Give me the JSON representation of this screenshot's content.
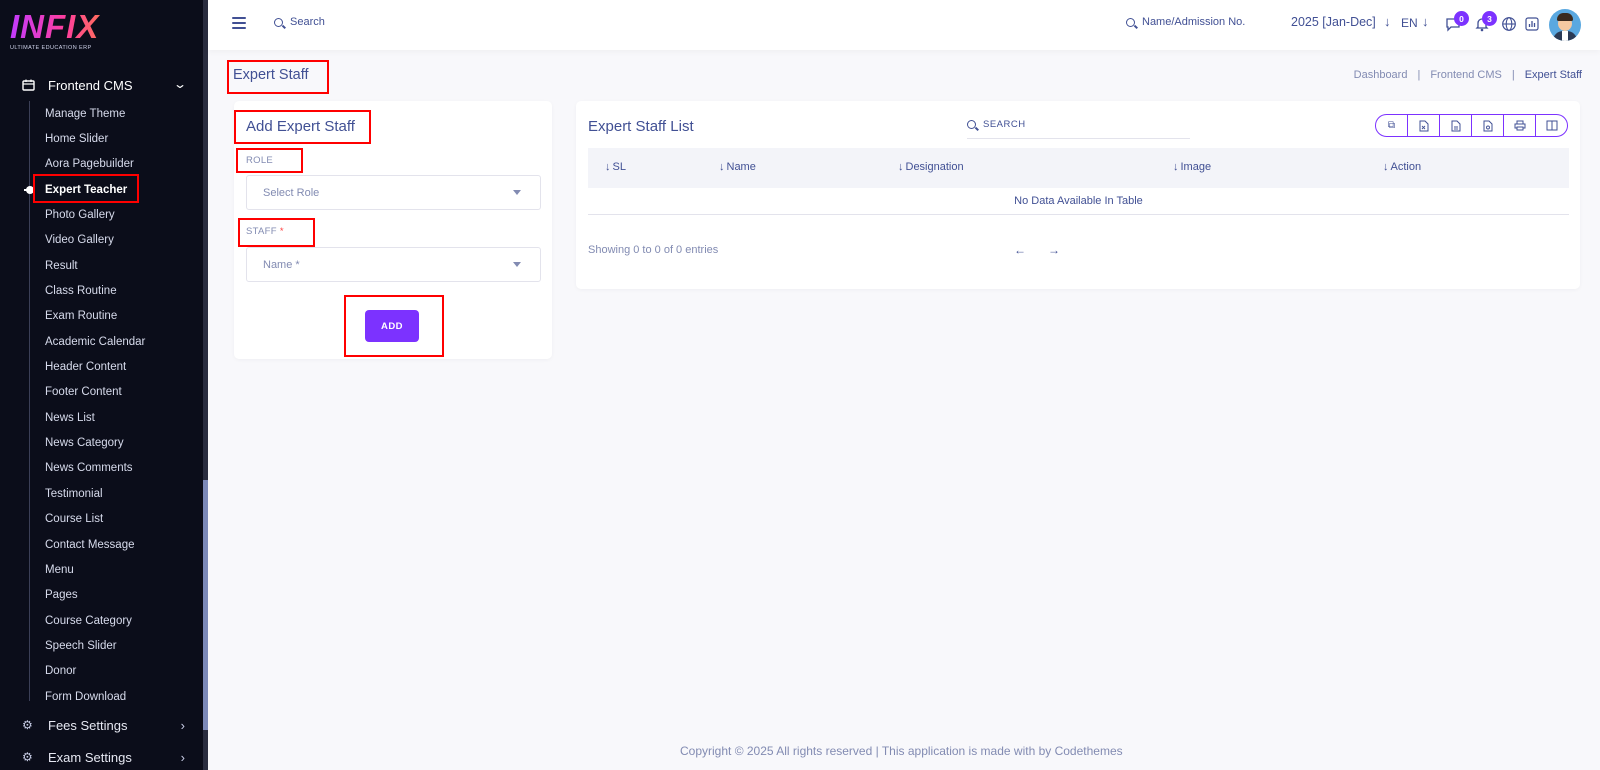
{
  "brand": {
    "logo_text": "INFIX",
    "tagline": "ULTIMATE EDUCATION ERP"
  },
  "sidebar": {
    "section_label": "Frontend CMS",
    "items": [
      "Manage Theme",
      "Home Slider",
      "Aora Pagebuilder",
      "Expert Teacher",
      "Photo Gallery",
      "Video Gallery",
      "Result",
      "Class Routine",
      "Exam Routine",
      "Academic Calendar",
      "Header Content",
      "Footer Content",
      "News List",
      "News Category",
      "News Comments",
      "Testimonial",
      "Course List",
      "Contact Message",
      "Menu",
      "Pages",
      "Course Category",
      "Speech Slider",
      "Donor",
      "Form Download"
    ],
    "active_item": "Expert Teacher",
    "fees_settings": "Fees Settings",
    "exam_settings": "Exam Settings"
  },
  "topbar": {
    "search_label": "Search",
    "admission_search": "Name/Admission No.",
    "year": "2025 [Jan-Dec]",
    "lang": "EN",
    "messages_count": "0",
    "notifications_count": "3"
  },
  "page": {
    "title": "Expert Staff",
    "breadcrumb": [
      "Dashboard",
      "Frontend CMS",
      "Expert Staff"
    ]
  },
  "form": {
    "title": "Add Expert Staff",
    "role_label": "ROLE",
    "role_placeholder": "Select Role",
    "staff_label": "STAFF",
    "staff_required": "*",
    "staff_placeholder": "Name *",
    "add_button": "ADD"
  },
  "list": {
    "title": "Expert Staff List",
    "search_label": "SEARCH",
    "columns": [
      "SL",
      "Name",
      "Designation",
      "Image",
      "Action"
    ],
    "empty_text": "No Data Available In Table",
    "showing": "Showing 0 to 0 of 0 entries"
  },
  "footer": {
    "text": "Copyright © 2025 All rights reserved | This application is made with by Codethemes"
  },
  "colors": {
    "accent": "#7c32ff",
    "text": "#415094",
    "muted": "#828bb2",
    "sidebar_bg": "#0b0d1a",
    "highlight": "#ff0000"
  }
}
